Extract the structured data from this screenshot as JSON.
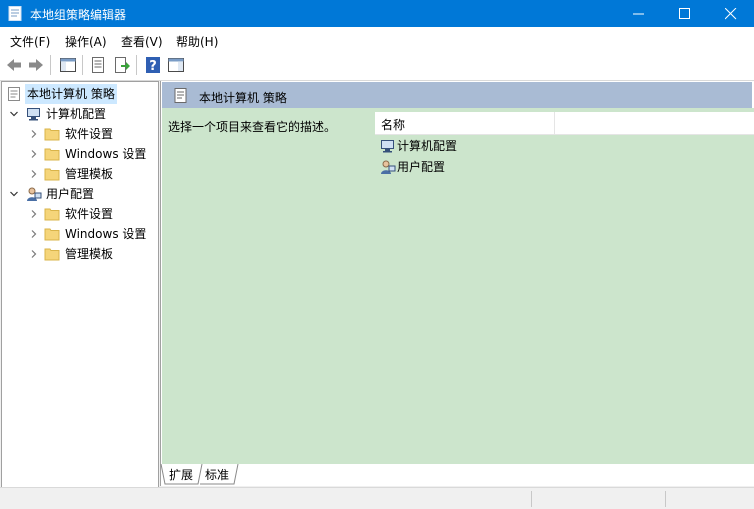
{
  "window": {
    "title": "本地组策略编辑器",
    "accent": "#0078d7"
  },
  "menu": {
    "items": [
      {
        "label": "文件(F)"
      },
      {
        "label": "操作(A)"
      },
      {
        "label": "查看(V)"
      },
      {
        "label": "帮助(H)"
      }
    ]
  },
  "toolbar": {
    "icons": [
      "back-arrow-icon",
      "forward-arrow-icon",
      "show-hide-tree-icon",
      "properties-icon",
      "export-list-icon",
      "help-icon",
      "show-hide-action-pane-icon"
    ]
  },
  "tree": {
    "root": {
      "label": "本地计算机 策略",
      "selected": true
    },
    "computer": {
      "label": "计算机配置",
      "children": [
        {
          "label": "软件设置"
        },
        {
          "label": "Windows 设置"
        },
        {
          "label": "管理模板"
        }
      ]
    },
    "user": {
      "label": "用户配置",
      "children": [
        {
          "label": "软件设置"
        },
        {
          "label": "Windows 设置"
        },
        {
          "label": "管理模板"
        }
      ]
    }
  },
  "main": {
    "header_title": "本地计算机 策略",
    "description": "选择一个项目来查看它的描述。",
    "column_name": "名称",
    "items": [
      {
        "label": "计算机配置",
        "icon": "computer-icon"
      },
      {
        "label": "用户配置",
        "icon": "user-icon"
      }
    ],
    "background": "#cce5cc"
  },
  "tabs": [
    {
      "label": "扩展",
      "active": true
    },
    {
      "label": "标准",
      "active": false
    }
  ]
}
